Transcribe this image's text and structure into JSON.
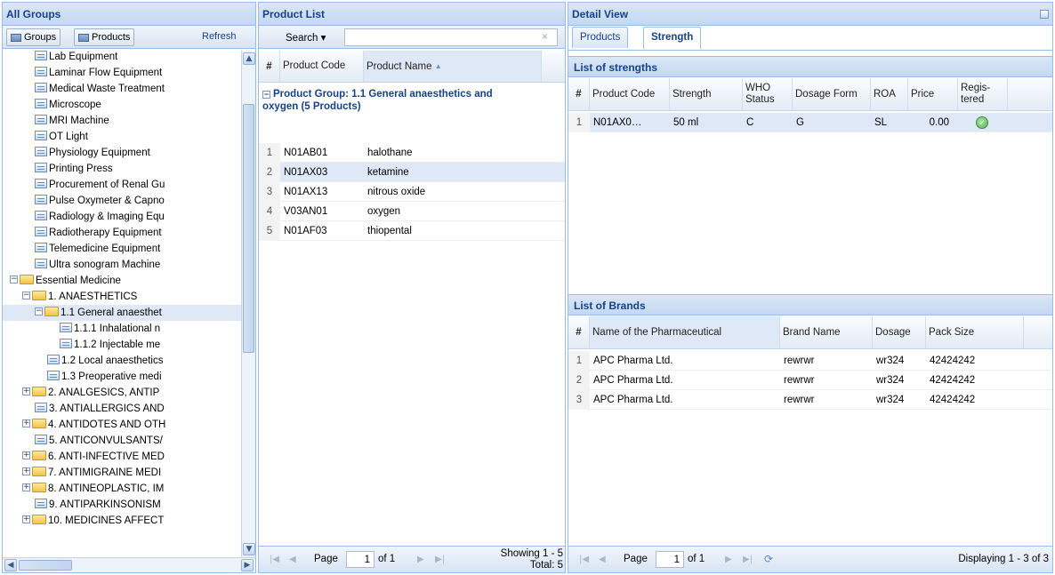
{
  "left": {
    "title": "All Groups",
    "buttons": {
      "groups": "Groups",
      "products": "Products",
      "refresh": "Refresh"
    },
    "tree": [
      {
        "label": "Lab Equipment",
        "type": "leaf",
        "indent": 3
      },
      {
        "label": "Laminar Flow Equipment",
        "type": "leaf",
        "indent": 3
      },
      {
        "label": "Medical Waste Treatment",
        "type": "leaf",
        "indent": 3
      },
      {
        "label": "Microscope",
        "type": "leaf",
        "indent": 3
      },
      {
        "label": "MRI Machine",
        "type": "leaf",
        "indent": 3
      },
      {
        "label": "OT Light",
        "type": "leaf",
        "indent": 3
      },
      {
        "label": "Physiology Equipment",
        "type": "leaf",
        "indent": 3
      },
      {
        "label": "Printing Press",
        "type": "leaf",
        "indent": 3
      },
      {
        "label": "Procurement of Renal Gu",
        "type": "leaf",
        "indent": 3
      },
      {
        "label": "Pulse Oxymeter & Capno",
        "type": "leaf",
        "indent": 3
      },
      {
        "label": "Radiology & Imaging Equ",
        "type": "leaf",
        "indent": 3
      },
      {
        "label": "Radiotherapy Equipment",
        "type": "leaf",
        "indent": 3
      },
      {
        "label": "Telemedicine Equipment",
        "type": "leaf",
        "indent": 3
      },
      {
        "label": "Ultra sonogram Machine",
        "type": "leaf",
        "indent": 3
      },
      {
        "label": "Essential Medicine",
        "type": "folder",
        "expander": "−",
        "indent": 1
      },
      {
        "label": "1. ANAESTHETICS",
        "type": "folder",
        "expander": "−",
        "indent": 2
      },
      {
        "label": "1.1 General anaesthet",
        "type": "folder",
        "expander": "−",
        "indent": 3,
        "selected": true
      },
      {
        "label": "1.1.1 Inhalational n",
        "type": "leaf",
        "indent": 5
      },
      {
        "label": "1.1.2 Injectable me",
        "type": "leaf",
        "indent": 5
      },
      {
        "label": "1.2 Local anaesthetics",
        "type": "leaf",
        "indent": 4
      },
      {
        "label": "1.3 Preoperative medi",
        "type": "leaf",
        "indent": 4
      },
      {
        "label": "2. ANALGESICS, ANTIP",
        "type": "folder",
        "expander": "+",
        "indent": 2
      },
      {
        "label": "3. ANTIALLERGICS AND",
        "type": "leaf",
        "indent": 3
      },
      {
        "label": "4. ANTIDOTES AND OTH",
        "type": "folder",
        "expander": "+",
        "indent": 2
      },
      {
        "label": "5. ANTICONVULSANTS/",
        "type": "leaf",
        "indent": 3
      },
      {
        "label": "6. ANTI-INFECTIVE MED",
        "type": "folder",
        "expander": "+",
        "indent": 2
      },
      {
        "label": "7. ANTIMIGRAINE MEDI",
        "type": "folder",
        "expander": "+",
        "indent": 2
      },
      {
        "label": "8. ANTINEOPLASTIC, IM",
        "type": "folder",
        "expander": "+",
        "indent": 2
      },
      {
        "label": "9. ANTIPARKINSONISM",
        "type": "leaf",
        "indent": 3
      },
      {
        "label": "10. MEDICINES AFFECT",
        "type": "folder",
        "expander": "+",
        "indent": 2
      }
    ]
  },
  "mid": {
    "title": "Product List",
    "search_label": "Search ▾",
    "search_value": "",
    "clear": "×",
    "headers": {
      "num": "#",
      "code": "Product Code",
      "name": "Product Name"
    },
    "sort_arrow": "▲",
    "group_label": "Product Group: 1.1 General anaesthetics and oxygen (5 Products)",
    "rows": [
      {
        "n": "1",
        "code": "N01AB01",
        "name": "halothane"
      },
      {
        "n": "2",
        "code": "N01AX03",
        "name": "ketamine",
        "selected": true
      },
      {
        "n": "3",
        "code": "N01AX13",
        "name": "nitrous oxide"
      },
      {
        "n": "4",
        "code": "V03AN01",
        "name": "oxygen"
      },
      {
        "n": "5",
        "code": "N01AF03",
        "name": "thiopental"
      }
    ],
    "pager": {
      "page_label": "Page",
      "page_value": "1",
      "of_label": "of 1",
      "showing": "Showing 1 - 5",
      "total": "Total: 5"
    }
  },
  "right": {
    "title": "Detail View",
    "tabs": [
      "Products",
      "Strength"
    ],
    "strengths_title": "List of strengths",
    "strength_headers": {
      "num": "#",
      "code": "Product Code",
      "strength": "Strength",
      "who": "WHO Status",
      "dosage": "Dosage Form",
      "roa": "ROA",
      "price": "Price",
      "registered": "Regis-tered"
    },
    "strength_rows": [
      {
        "n": "1",
        "code": "N01AX0…",
        "strength": "50 ml",
        "who": "C",
        "dosage": "G",
        "roa": "SL",
        "price": "0.00",
        "registered": "yes"
      }
    ],
    "brands_title": "List of Brands",
    "brand_headers": {
      "num": "#",
      "pharma": "Name of the Pharmaceutical",
      "brand": "Brand Name",
      "dosage": "Dosage",
      "pack": "Pack Size"
    },
    "brand_rows": [
      {
        "n": "1",
        "pharma": "APC Pharma Ltd.",
        "brand": "rewrwr",
        "dosage": "wr324",
        "pack": "42424242"
      },
      {
        "n": "2",
        "pharma": "APC Pharma Ltd.",
        "brand": "rewrwr",
        "dosage": "wr324",
        "pack": "42424242"
      },
      {
        "n": "3",
        "pharma": "APC Pharma Ltd.",
        "brand": "rewrwr",
        "dosage": "wr324",
        "pack": "42424242"
      }
    ],
    "pager": {
      "page_label": "Page",
      "page_value": "1",
      "of_label": "of 1",
      "displaying": "Displaying 1 - 3 of 3"
    }
  },
  "colors": {
    "panel_title": "#15428b",
    "border": "#99bbe8",
    "selection": "#dfe8f6",
    "check": "#5cb85c"
  }
}
